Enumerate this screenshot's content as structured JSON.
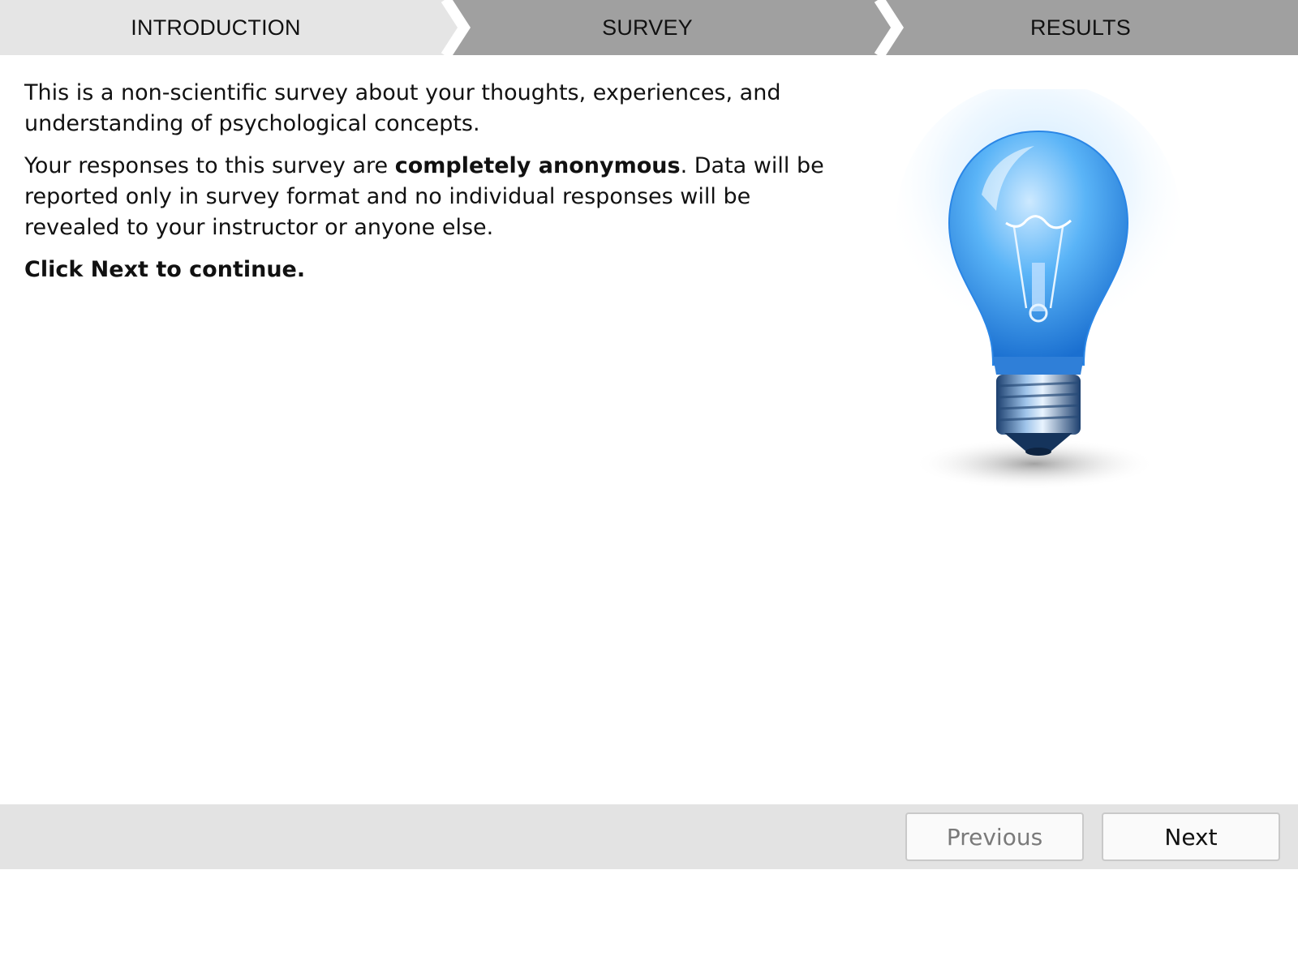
{
  "steps": [
    {
      "label": "INTRODUCTION",
      "state": "active"
    },
    {
      "label": "SURVEY",
      "state": "pending"
    },
    {
      "label": "RESULTS",
      "state": "pending"
    }
  ],
  "content": {
    "intro": "This is a non-scientific survey about your thoughts, experiences, and understanding of psychological concepts.",
    "privacy_before": "Your responses to this survey are ",
    "privacy_bold": "completely anonymous",
    "privacy_after": ". Data will be reported only in survey format and no individual responses will be revealed to your instructor or anyone else.",
    "instruction": "Click Next to continue."
  },
  "illustration": {
    "icon": "light-bulb-icon"
  },
  "footer": {
    "previous_label": "Previous",
    "next_label": "Next",
    "previous_enabled": false
  },
  "colors": {
    "step_active": "#e5e5e5",
    "step_inactive": "#a0a0a0",
    "footer_bg": "#e3e3e3",
    "bulb_blue": "#3a9ff0"
  }
}
